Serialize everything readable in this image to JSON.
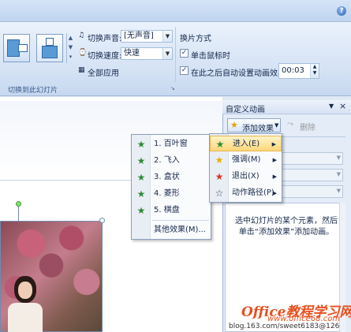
{
  "ribbon": {
    "help_label": "?",
    "sound_label": "切换声音:",
    "sound_value": "[无声音]",
    "speed_label": "切换速度:",
    "speed_value": "快速",
    "apply_all_label": "全部应用",
    "advance_title": "换片方式",
    "on_click_label": "单击鼠标时",
    "after_label": "在此之后自动设置动画效果:",
    "after_value": "00:03",
    "group_label": "切换到此幻灯片"
  },
  "pane": {
    "title": "自定义动画",
    "add_effect_label": "添加效果",
    "delete_label": "删除",
    "hint": "选中幻灯片的某个元素，然后单击“添加效果”添加动画。"
  },
  "effect_menu": {
    "items": [
      {
        "label": "进入(E)",
        "icon": "star-green-icon"
      },
      {
        "label": "强调(M)",
        "icon": "star-yellow-icon"
      },
      {
        "label": "退出(X)",
        "icon": "star-red-icon"
      },
      {
        "label": "动作路径(P)",
        "icon": "star-outline-icon"
      }
    ]
  },
  "entrance_menu": {
    "items": [
      {
        "label": "1. 百叶窗"
      },
      {
        "label": "2. 飞入"
      },
      {
        "label": "3. 盒状"
      },
      {
        "label": "4. 菱形"
      },
      {
        "label": "5. 棋盘"
      }
    ],
    "more_label": "其他效果(M)..."
  },
  "watermark": {
    "brand": "Office教程学习网",
    "url": "www.office68.com",
    "blog": "blog.163.com/sweet6183@126"
  }
}
